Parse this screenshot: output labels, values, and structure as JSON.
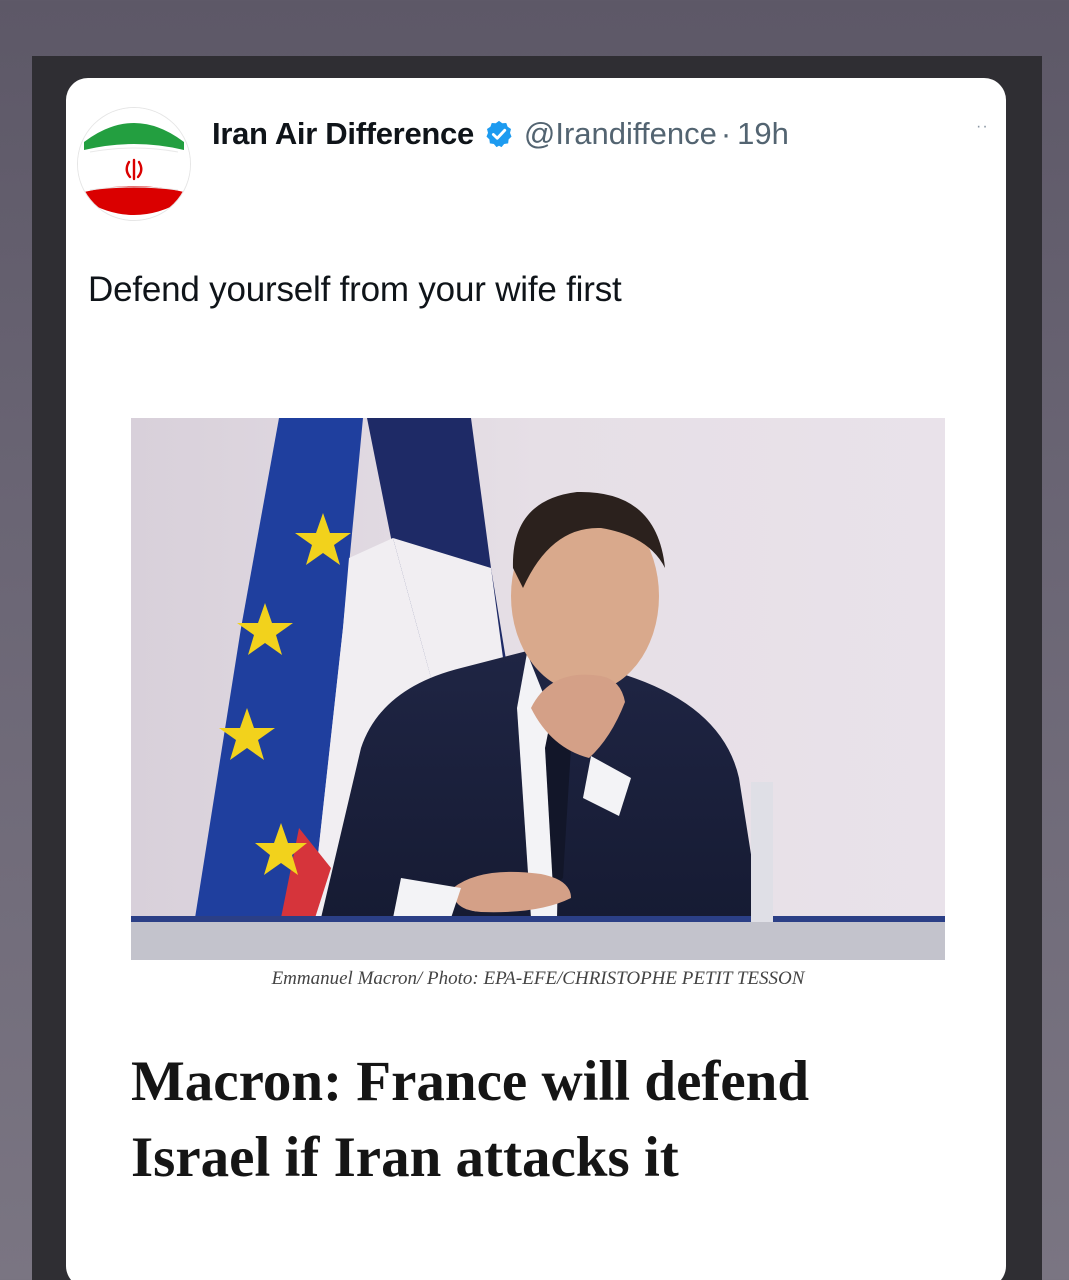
{
  "post": {
    "author": {
      "display_name": "Iran Air Difference",
      "handle": "@Irandiffence",
      "separator": "·",
      "time": "19h",
      "verified_icon": "verified-badge-icon",
      "avatar_icon": "iran-flag-icon"
    },
    "more_icon": "more-icon",
    "more_glyph": "··",
    "text": "Defend yourself from your wife first",
    "media": {
      "photo_caption": "Emmanuel Macron/ Photo: EPA-EFE/CHRISTOPHE PETIT TESSON",
      "headline_line1": "Macron: France will defend",
      "headline_line2": "Israel if Iran attacks it"
    }
  },
  "colors": {
    "verified_blue": "#1d9bf0",
    "flag_green": "#239f40",
    "flag_red": "#da0000",
    "text_primary": "#0f1419",
    "text_secondary": "#536471"
  }
}
